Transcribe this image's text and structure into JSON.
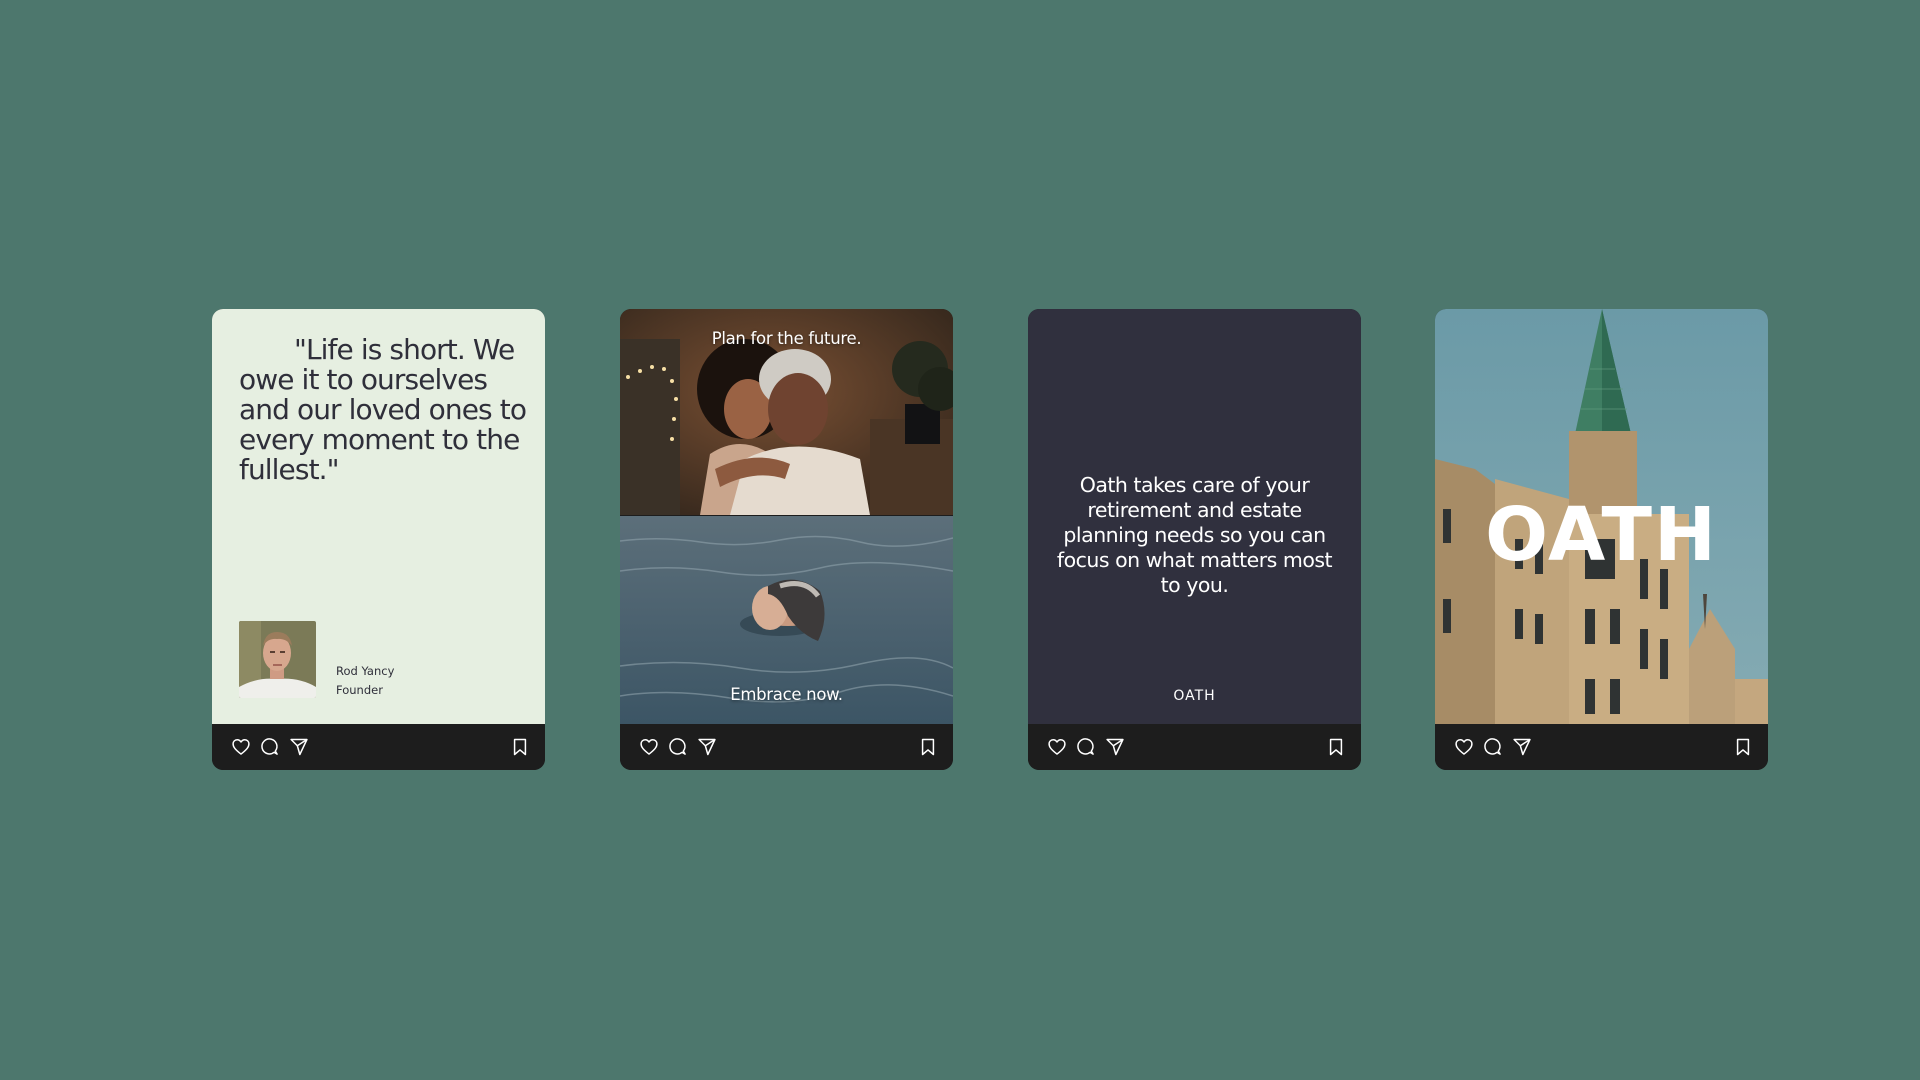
{
  "colors": {
    "background": "#4d776d",
    "quote_card_bg": "#e6efe1",
    "statement_card_bg": "#30303e",
    "action_bar_bg": "#1d1d1d"
  },
  "action_icons": [
    "heart-icon",
    "comment-icon",
    "send-icon",
    "bookmark-icon"
  ],
  "posts": [
    {
      "quote_first_line": "\"Life is short.",
      "quote_rest": "We owe it to ourselves and our loved ones to every moment to the fullest.\"",
      "person_name": "Rod Yancy",
      "person_role": "Founder"
    },
    {
      "top_caption": "Plan for the future.",
      "bottom_caption": "Embrace now."
    },
    {
      "statement": "Oath takes care of your retirement and estate planning needs so you can focus on what matters most to you.",
      "brand": "OATH"
    },
    {
      "brand": "OATH"
    }
  ]
}
